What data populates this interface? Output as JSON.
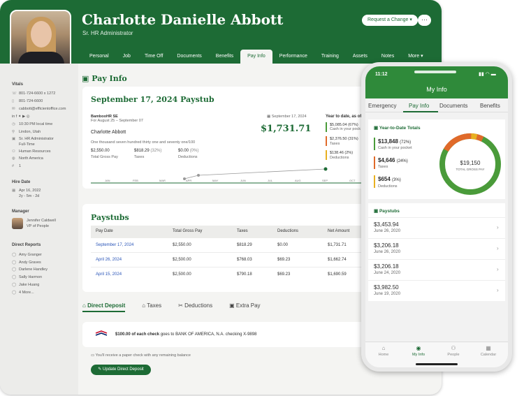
{
  "employee": {
    "name": "Charlotte Danielle Abbott",
    "title": "Sr. HR Administrator"
  },
  "header_actions": {
    "request_change": "Request a Change ▾",
    "more": "···"
  },
  "tabs": [
    "Personal",
    "Job",
    "Time Off",
    "Documents",
    "Benefits",
    "Pay Info",
    "Performance",
    "Training",
    "Assets",
    "Notes",
    "More ▾"
  ],
  "active_tab": "Pay Info",
  "sidebar": {
    "vitals_heading": "Vitals",
    "vitals": [
      {
        "icon": "phone-icon",
        "text": "801-724-6600 x 1272"
      },
      {
        "icon": "mobile-icon",
        "text": "801-724-6600"
      },
      {
        "icon": "email-icon",
        "text": "cabbott@efficientoffice.com"
      },
      {
        "icon": "social-icons",
        "text": "in  f  ✦  ▶  ◎"
      },
      {
        "icon": "clock-icon",
        "text": "10:30 PM local time"
      },
      {
        "icon": "location-icon",
        "text": "Lindon, Utah"
      },
      {
        "icon": "briefcase-icon",
        "text": "Sr. HR Administrator"
      },
      {
        "icon": "",
        "text": "Full-Time"
      },
      {
        "icon": "people-icon",
        "text": "Human Resources"
      },
      {
        "icon": "globe-icon",
        "text": "North America"
      },
      {
        "icon": "hash-icon",
        "text": "1"
      }
    ],
    "hire_heading": "Hire Date",
    "hire_date": "Apr 16, 2022",
    "hire_tenure": "2y - 5m - 2d",
    "manager_heading": "Manager",
    "manager_name": "Jennifer Caldwell",
    "manager_title": "VP of People",
    "reports_heading": "Direct Reports",
    "reports": [
      "Amy Granger",
      "Andy Graves",
      "Darlene Handley",
      "Sally Harmon",
      "Jake Huang",
      "4 More..."
    ]
  },
  "pay_info": {
    "section_title": "Pay Info",
    "stub_date": "September 17, 2024 Paystub",
    "company": "BambooHR SE",
    "period": "For August 25 – September 07",
    "pay_date": "September 17, 2024",
    "payee": "Charlotte Abbott",
    "amount_words": "One thousand seven hundred thirty one and seventy one/100",
    "net_pay": "$1,731.71",
    "gross": {
      "value": "$2,550.00",
      "label": "Total Gross Pay"
    },
    "taxes": {
      "value": "$818.29",
      "pct": "(32%)",
      "label": "Taxes"
    },
    "deductions": {
      "value": "$0.00",
      "pct": "(0%)",
      "label": "Deductions"
    },
    "ytd_heading": "Year to date, as of S",
    "ytd": [
      {
        "value": "$5,085.04",
        "pct": "(67%)",
        "label": "Cash in your pock",
        "color": "#4a9b3a"
      },
      {
        "value": "$2,376.50",
        "pct": "(31%)",
        "label": "Taxes",
        "color": "#e06a2a"
      },
      {
        "value": "$138.46",
        "pct": "(2%)",
        "label": "Deductions",
        "color": "#e8b020"
      }
    ],
    "timeline": [
      "JAN",
      "FEB",
      "MAR",
      "APR",
      "MAY",
      "JUN",
      "JUL",
      "AUG",
      "SEP",
      "OCT"
    ]
  },
  "paystubs": {
    "section_title": "Paystubs",
    "headers": [
      "Pay Date",
      "Total Gross Pay",
      "Taxes",
      "Deductions",
      "Net Amount"
    ],
    "rows": [
      [
        "September 17, 2024",
        "$2,550.00",
        "$818.29",
        "$0.00",
        "$1,731.71"
      ],
      [
        "April 26, 2024",
        "$2,500.00",
        "$768.03",
        "$69.23",
        "$1,662.74"
      ],
      [
        "April 15, 2024",
        "$2,500.00",
        "$790.18",
        "$69.23",
        "$1,690.59"
      ]
    ]
  },
  "subtabs": [
    "Direct Deposit",
    "Taxes",
    "Deductions",
    "Extra Pay"
  ],
  "direct_deposit": {
    "amount_bold": "$100.00 of each check",
    "amount_rest": " goes to BANK OF AMERICA, N.A. checking X-9898",
    "paper_note": "You'll receive a paper check with any remaining balance",
    "update_button": "Update Direct Deposit"
  },
  "phone": {
    "time": "11:12",
    "title": "My Info",
    "tabs": [
      "Emergency",
      "Pay Info",
      "Documents",
      "Benefits"
    ],
    "ytd_heading": "Year-to-Date Totals",
    "ytd": [
      {
        "value": "$13,848",
        "pct": "(72%)",
        "label": "Cash in your pocket",
        "color": "#4a9b3a"
      },
      {
        "value": "$4,646",
        "pct": "(24%)",
        "label": "Taxes",
        "color": "#e06a2a"
      },
      {
        "value": "$654",
        "pct": "(3%)",
        "label": "Deductions",
        "color": "#e8b020"
      }
    ],
    "donut_total": "$19,150",
    "donut_label": "TOTAL GROSS PAY",
    "paystubs_heading": "Paystubs",
    "paystubs": [
      {
        "amount": "$3,453.94",
        "date": "June 26, 2020"
      },
      {
        "amount": "$3,206.18",
        "date": "June 26, 2020"
      },
      {
        "amount": "$3,206.18",
        "date": "June 24, 2020"
      },
      {
        "amount": "$3,982.50",
        "date": "June 19, 2020"
      }
    ],
    "nav": [
      "Home",
      "My Info",
      "People",
      "Calendar"
    ]
  }
}
